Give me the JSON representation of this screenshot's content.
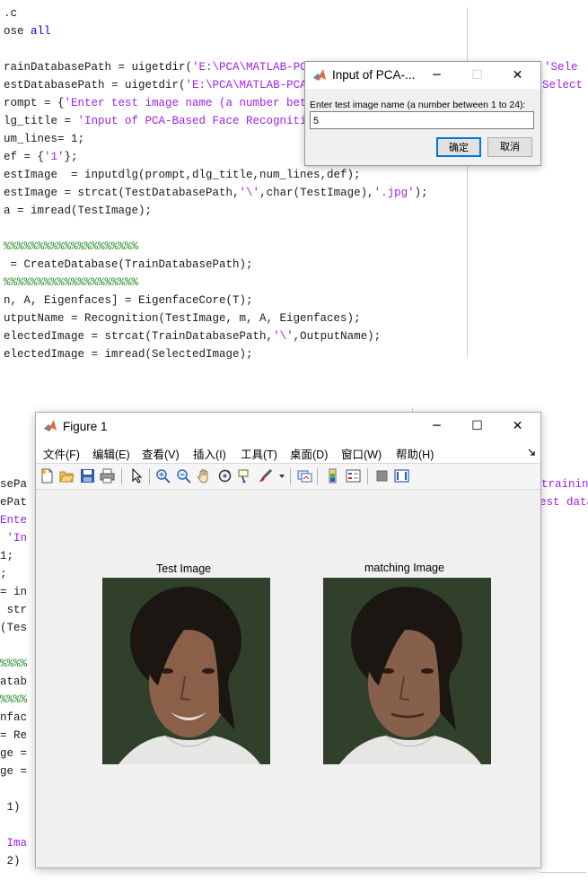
{
  "editor_top": {
    "lines": [
      {
        "segments": [
          {
            "t": ".c",
            "c": "plain"
          }
        ]
      },
      {
        "segments": [
          {
            "t": "ose ",
            "c": "plain"
          },
          {
            "t": "all",
            "c": "kw"
          }
        ]
      },
      {
        "segments": []
      },
      {
        "segments": [
          {
            "t": "rainDatabasePath = uigetdir(",
            "c": "plain"
          },
          {
            "t": "'E:\\PCA\\MATLAB-PCA\\ww",
            "c": "str"
          }
        ]
      },
      {
        "segments": [
          {
            "t": "estDatabasePath = uigetdir(",
            "c": "plain"
          },
          {
            "t": "'E:\\PCA\\MATLAB-PCA\\ww",
            "c": "str"
          }
        ]
      },
      {
        "segments": [
          {
            "t": "rompt = {",
            "c": "plain"
          },
          {
            "t": "'Enter test image name (a number betwee",
            "c": "str"
          }
        ]
      },
      {
        "segments": [
          {
            "t": "lg_title = ",
            "c": "plain"
          },
          {
            "t": "'Input of PCA-Based Face Recognition S",
            "c": "str"
          }
        ]
      },
      {
        "segments": [
          {
            "t": "um_lines= 1;",
            "c": "plain"
          }
        ]
      },
      {
        "segments": [
          {
            "t": "ef = {",
            "c": "plain"
          },
          {
            "t": "'1'",
            "c": "str"
          },
          {
            "t": "};",
            "c": "plain"
          }
        ]
      },
      {
        "segments": [
          {
            "t": "estImage  = inputdlg(prompt,dlg_title,num_lines,def);",
            "c": "plain"
          }
        ]
      },
      {
        "segments": [
          {
            "t": "estImage = strcat(TestDatabasePath,",
            "c": "plain"
          },
          {
            "t": "'\\'",
            "c": "str"
          },
          {
            "t": ",char(TestImage),",
            "c": "plain"
          },
          {
            "t": "'.jpg'",
            "c": "str"
          },
          {
            "t": ");",
            "c": "plain"
          }
        ]
      },
      {
        "segments": [
          {
            "t": "a = imread(TestImage);",
            "c": "plain"
          }
        ]
      },
      {
        "segments": []
      },
      {
        "segments": [
          {
            "t": "%%%%%%%%%%%%%%%%%%%%",
            "c": "cmt"
          }
        ]
      },
      {
        "segments": [
          {
            "t": " = CreateDatabase(TrainDatabasePath);",
            "c": "plain"
          }
        ]
      },
      {
        "segments": [
          {
            "t": "%%%%%%%%%%%%%%%%%%%%",
            "c": "cmt"
          }
        ]
      },
      {
        "segments": [
          {
            "t": "n, A, Eigenfaces] = EigenfaceCore(T);",
            "c": "plain"
          }
        ]
      },
      {
        "segments": [
          {
            "t": "utputName = Recognition(TestImage, m, A, Eigenfaces);",
            "c": "plain"
          }
        ]
      },
      {
        "segments": [
          {
            "t": "electedImage = strcat(TrainDatabasePath,",
            "c": "plain"
          },
          {
            "t": "'\\'",
            "c": "str"
          },
          {
            "t": ",OutputName);",
            "c": "plain"
          }
        ]
      },
      {
        "segments": [
          {
            "t": "electedImage = imread(SelectedImage);",
            "c": "plain"
          }
        ]
      }
    ],
    "right_fragments": [
      "'Sele",
      "Select"
    ]
  },
  "input_dialog": {
    "title": "Input of PCA-...",
    "prompt": "Enter test image name (a number between 1 to 24):",
    "value": "5",
    "ok_label": "确定",
    "cancel_label": "取消"
  },
  "editor_bottom": {
    "lines": [
      {
        "t": "sePa",
        "c": "plain"
      },
      {
        "t": "ePat",
        "c": "plain"
      },
      {
        "t": "Ente",
        "c": "str"
      },
      {
        "t": " 'In",
        "c": "str"
      },
      {
        "t": "1;",
        "c": "plain"
      },
      {
        "t": ";",
        "c": "plain"
      },
      {
        "t": "= in",
        "c": "plain"
      },
      {
        "t": " str",
        "c": "plain"
      },
      {
        "t": "(Tes",
        "c": "plain"
      },
      {
        "t": "",
        "c": "plain"
      },
      {
        "t": "%%%%",
        "c": "cmt"
      },
      {
        "t": "atab",
        "c": "plain"
      },
      {
        "t": "%%%%",
        "c": "cmt"
      },
      {
        "t": "nfac",
        "c": "plain"
      },
      {
        "t": "= Re",
        "c": "plain"
      },
      {
        "t": "ge =",
        "c": "plain"
      },
      {
        "t": "ge =",
        "c": "plain"
      },
      {
        "t": "",
        "c": "plain"
      },
      {
        "t": " 1)",
        "c": "plain"
      },
      {
        "t": "",
        "c": "plain"
      },
      {
        "t": " Ima",
        "c": "str"
      },
      {
        "t": " 2)",
        "c": "plain"
      }
    ],
    "right_fragments": [
      "trainin",
      "est data"
    ]
  },
  "figure": {
    "title": "Figure 1",
    "menus": [
      "文件(F)",
      "编辑(E)",
      "查看(V)",
      "插入(I)",
      "工具(T)",
      "桌面(D)",
      "窗口(W)",
      "帮助(H)"
    ],
    "overflow_icon": "double-arrow",
    "left_title": "Test Image",
    "right_title": "matching Image"
  },
  "colors": {
    "keyword": "#0000ff",
    "string": "#a020f0",
    "comment": "#228b22",
    "dialog_bg": "#f0f0f0",
    "ok_border": "#0078d7"
  },
  "window_controls": {
    "minimize": "─",
    "maximize": "☐",
    "close": "✕"
  }
}
